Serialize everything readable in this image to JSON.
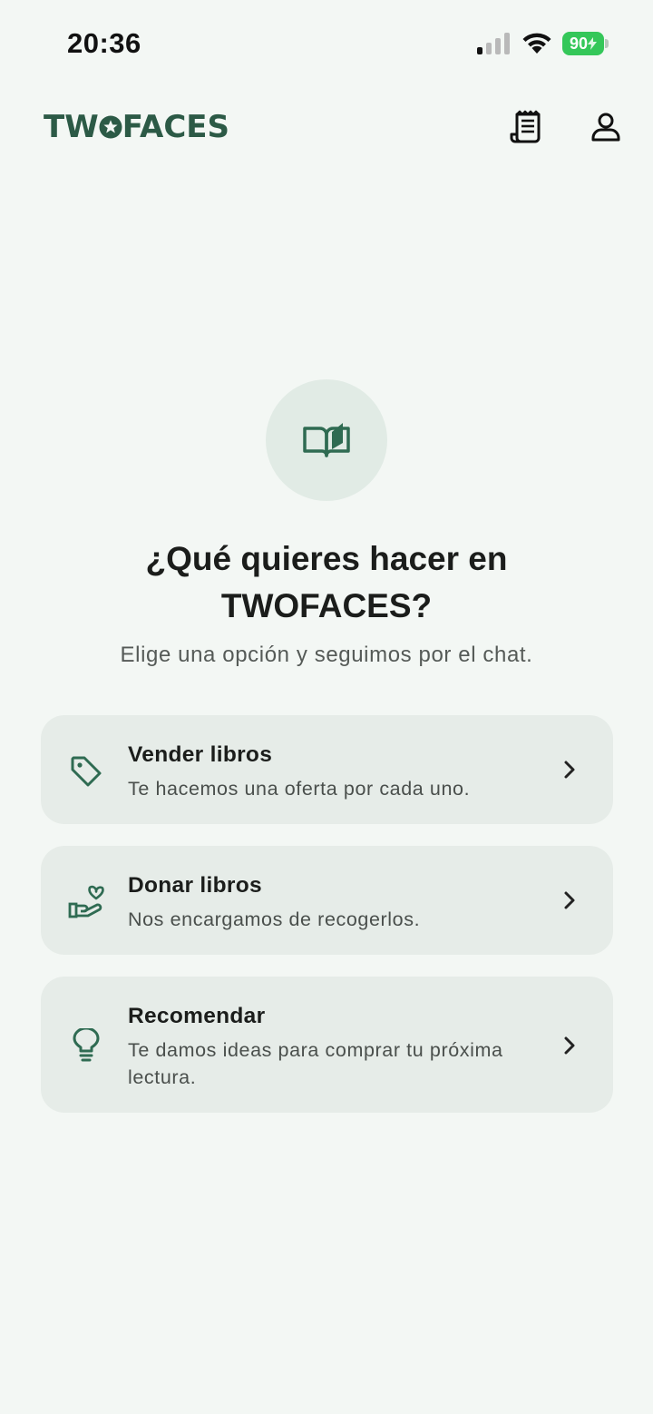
{
  "status_bar": {
    "time": "20:36",
    "battery_level": "90",
    "battery_color": "#34c759",
    "icons": [
      "cellular-signal-icon",
      "wifi-icon",
      "battery-charging-icon"
    ]
  },
  "header": {
    "logo_text_left": "TW",
    "logo_text_right": "FACES",
    "brand_color": "#2c5a46",
    "actions": [
      {
        "icon": "receipt-icon"
      },
      {
        "icon": "user-icon"
      }
    ]
  },
  "hero": {
    "icon": "open-book-icon",
    "title": "¿Qué quieres hacer en TWOFACES?",
    "subtitle": "Elige una opción y seguimos por el chat."
  },
  "options": [
    {
      "icon": "tag-icon",
      "title": "Vender libros",
      "description": "Te hacemos una oferta por cada uno."
    },
    {
      "icon": "heart-hand-icon",
      "title": "Donar libros",
      "description": "Nos encargamos de recogerlos."
    },
    {
      "icon": "lightbulb-icon",
      "title": "Recomendar",
      "description": "Te damos ideas para comprar tu próxima lectura."
    }
  ],
  "colors": {
    "background": "#f3f7f4",
    "card_background": "#e6ece8",
    "accent_green": "#2f6b52"
  }
}
